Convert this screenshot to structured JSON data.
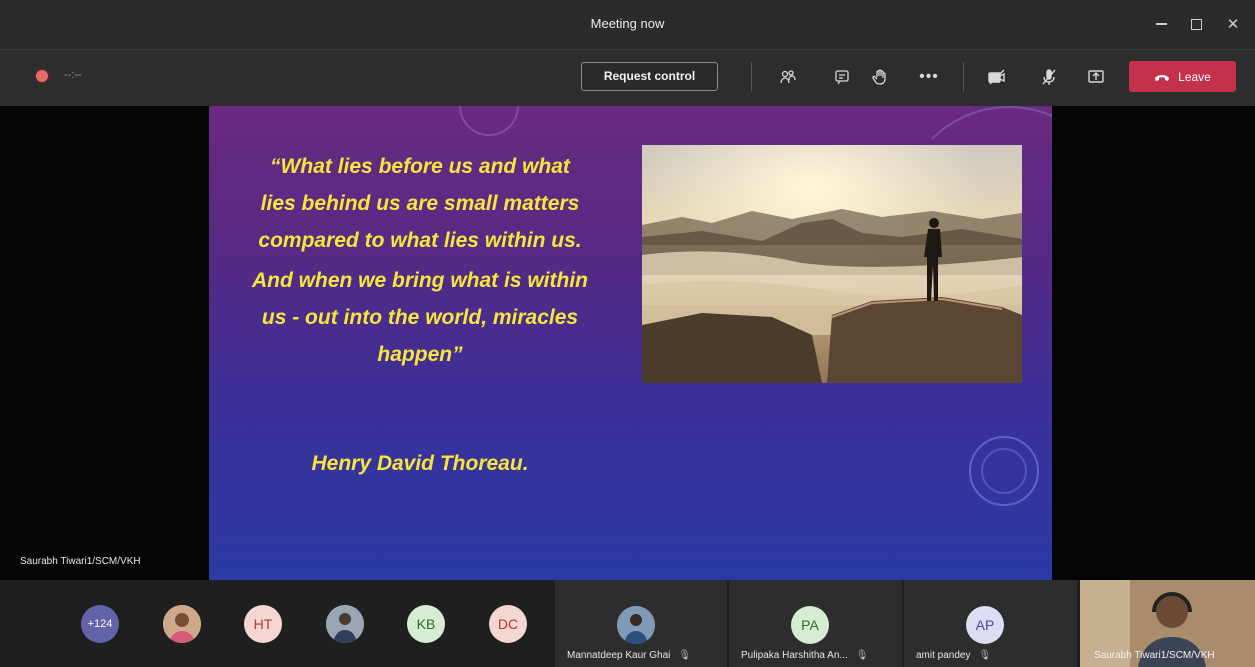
{
  "window": {
    "title": "Meeting now"
  },
  "toolbar": {
    "recording_time": "--:--",
    "request_control_label": "Request control",
    "leave_label": "Leave"
  },
  "slide": {
    "quote_lines": [
      "“What lies before us and what",
      "lies behind us are small matters",
      "compared to what lies within us.",
      "And when we bring what is within",
      "us - out into the world, miracles",
      "happen”"
    ],
    "author": "Henry David Thoreau."
  },
  "presenter": {
    "name": "Saurabh Tiwari1/SCM/VKH"
  },
  "participants": {
    "overflow_count": "+124",
    "avatars": [
      {
        "initials": "HT"
      },
      {
        "initials": "KB"
      },
      {
        "initials": "DC"
      }
    ],
    "tiles": [
      {
        "name": "Mannatdeep Kaur Ghai"
      },
      {
        "name": "Pulipaka Harshitha An...",
        "initials": "PA"
      },
      {
        "name": "amit pandey",
        "initials": "AP"
      }
    ],
    "self_name": "Saurabh Tiwari1/SCM/VKH"
  },
  "colors": {
    "leave": "#c4314b",
    "quote_text": "#f5e63c",
    "more_avatar": "#6264a7"
  }
}
